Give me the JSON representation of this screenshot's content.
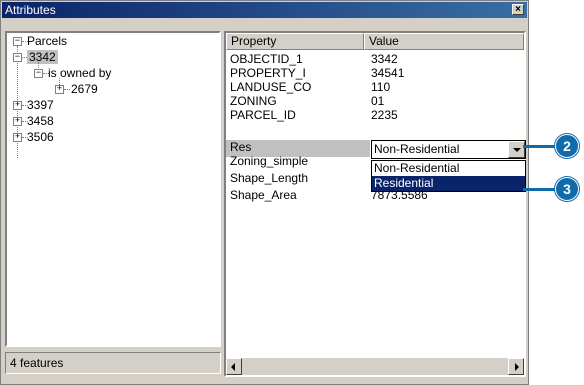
{
  "window": {
    "title": "Attributes",
    "close_glyph": "×"
  },
  "tree": {
    "root": "Parcels",
    "selected": "3342",
    "relation": "is owned by",
    "related": "2679",
    "others": [
      "3397",
      "3458",
      "3506"
    ]
  },
  "status": {
    "features": "4 features"
  },
  "grid": {
    "headers": {
      "property": "Property",
      "value": "Value"
    },
    "rows": [
      {
        "property": "OBJECTID_1",
        "value": "3342"
      },
      {
        "property": "PROPERTY_I",
        "value": "34541"
      },
      {
        "property": "LANDUSE_CO",
        "value": "110"
      },
      {
        "property": "ZONING",
        "value": "01"
      },
      {
        "property": "PARCEL_ID",
        "value": "2235"
      },
      {
        "property": "Res",
        "value": "Non-Residential"
      },
      {
        "property": "Zoning_simple",
        "value": ""
      },
      {
        "property": "Shape_Length",
        "value": ""
      },
      {
        "property": "Shape_Area",
        "value": "7873.5586"
      }
    ],
    "dropdown_options": [
      "Non-Residential",
      "Residential"
    ],
    "dropdown_selected": "Residential"
  },
  "callouts": [
    "2",
    "3"
  ],
  "colors": {
    "callout": "#0f6cab",
    "selection": "#0a246a"
  }
}
